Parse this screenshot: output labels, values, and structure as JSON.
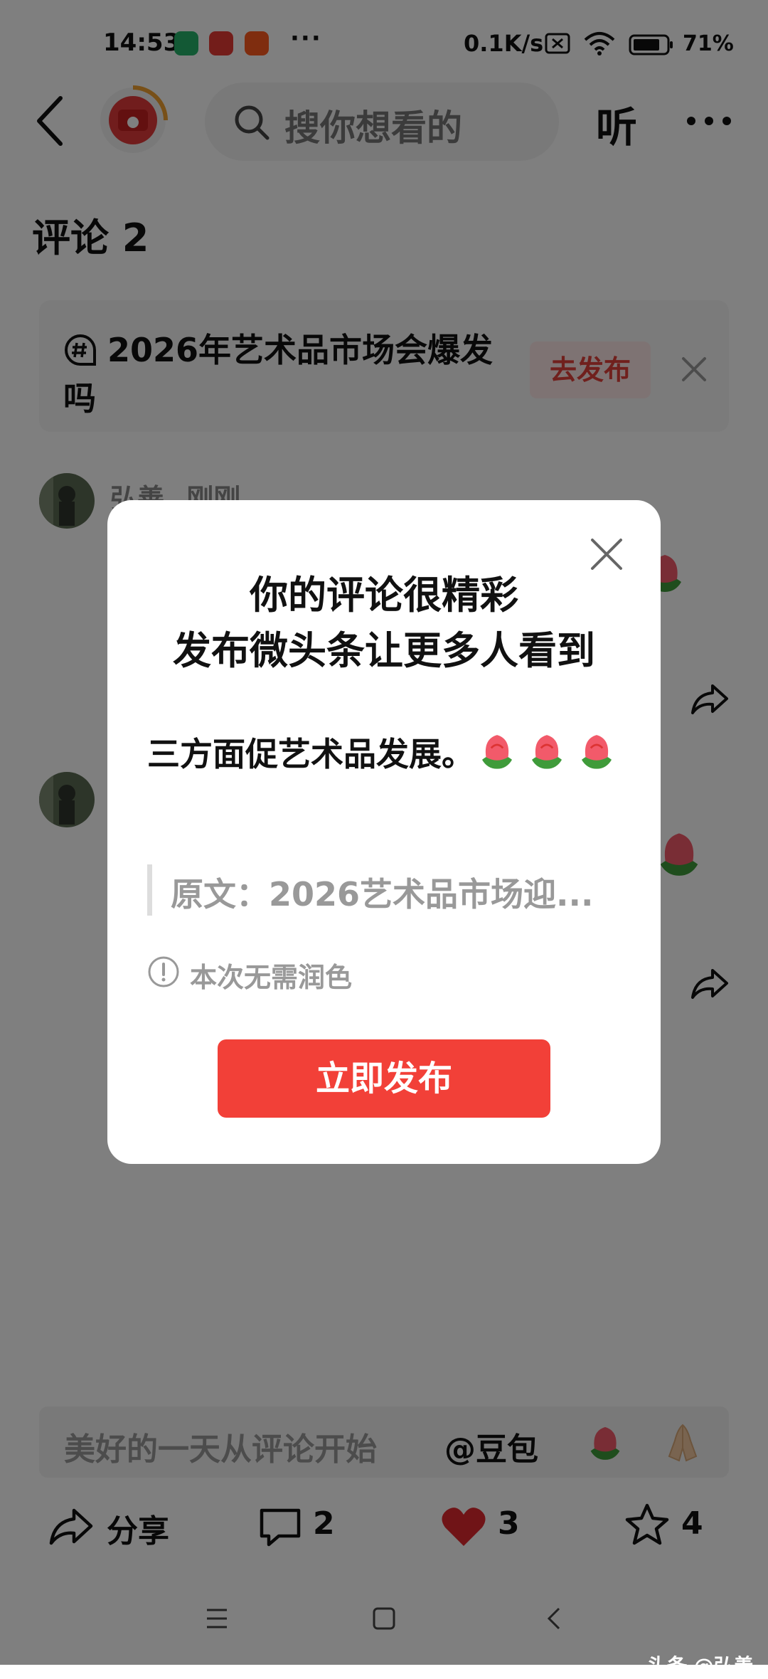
{
  "status_bar": {
    "time": "14:53",
    "more": "···",
    "net_speed": "0.1K/s",
    "battery": "71%"
  },
  "header": {
    "search_placeholder": "搜你想看的",
    "listen_label": "听"
  },
  "comments": {
    "title": "评论 2",
    "topic_text": "2026年艺术品市场会爆发吗",
    "topic_button": "去发布",
    "first_comment_author": "弘善",
    "first_comment_time": "刚刚"
  },
  "input_bar": {
    "placeholder": "美好的一天从评论开始",
    "at_label": "@豆包"
  },
  "actions": {
    "share_label": "分享",
    "comment_count": "2",
    "like_count": "3",
    "favorite_count": "4"
  },
  "dialog": {
    "title_line1": "你的评论很精彩",
    "title_line2": "发布微头条让更多人看到",
    "comment_text": "三方面促艺术品发展。",
    "quote_text": "原文：2026艺术品市场迎...",
    "info_text": "本次无需润色",
    "publish_button": "立即发布"
  },
  "watermark": "头条 @弘善",
  "colors": {
    "accent_red": "#f24038",
    "topic_button_bg": "#fde7e7",
    "like_red": "#e0282e",
    "overlay": "rgba(0,0,0,0.5)"
  },
  "icons": [
    "back-icon",
    "search-icon",
    "more-icon",
    "hashtag-icon",
    "close-icon",
    "share-icon",
    "comment-icon",
    "heart-icon",
    "star-icon",
    "rose-emoji",
    "praying-hands-emoji",
    "info-icon"
  ]
}
